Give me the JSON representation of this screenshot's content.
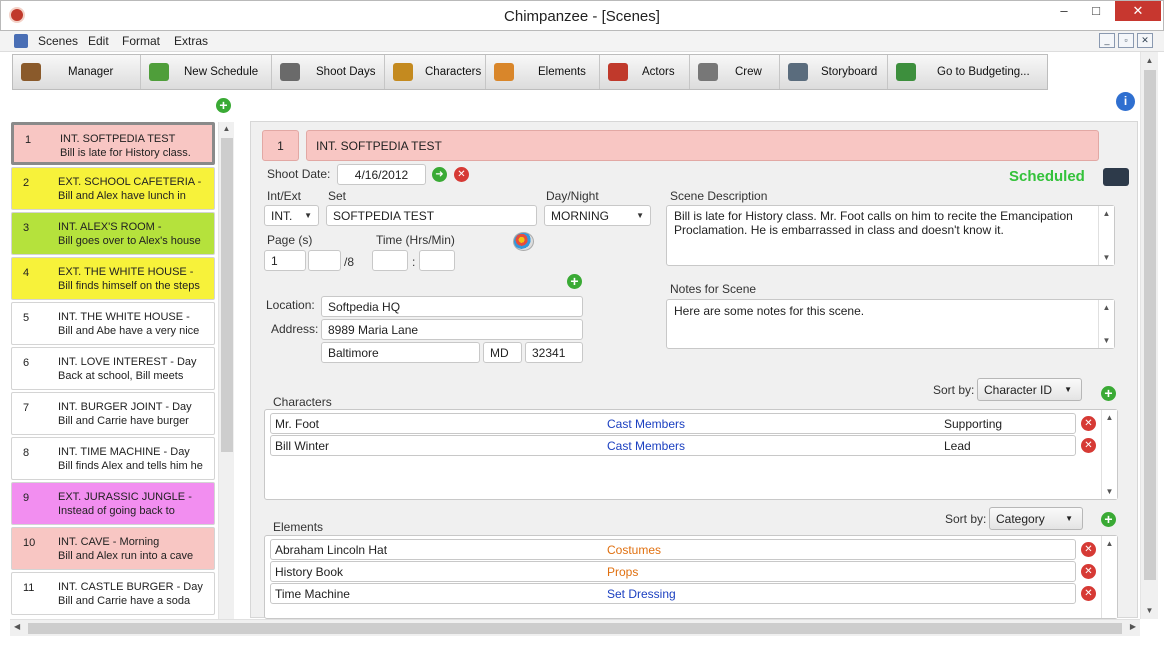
{
  "window": {
    "title": "Chimpanzee - [Scenes]",
    "minimize": "–",
    "maximize": "□",
    "close": "✕"
  },
  "menu": {
    "items": [
      "Scenes",
      "Edit",
      "Format",
      "Extras"
    ],
    "mdi": [
      "_",
      "▫",
      "✕"
    ]
  },
  "toolbar": {
    "buttons": [
      {
        "label": "Manager",
        "icon": "briefcase-icon",
        "color": "#8a5a2b"
      },
      {
        "label": "New Schedule",
        "icon": "new-schedule-icon",
        "color": "#4f9e3a"
      },
      {
        "label": "Shoot Days",
        "icon": "calendar-icon",
        "color": "#6a6a6a"
      },
      {
        "label": "Characters",
        "icon": "character-icon",
        "color": "#c48a1f"
      },
      {
        "label": "Elements",
        "icon": "gun-icon",
        "color": "#d9862a"
      },
      {
        "label": "Actors",
        "icon": "actor-icon",
        "color": "#c0392b"
      },
      {
        "label": "Crew",
        "icon": "wrench-icon",
        "color": "#777777"
      },
      {
        "label": "Storyboard",
        "icon": "storyboard-icon",
        "color": "#5a6c7d"
      },
      {
        "label": "Go to Budgeting...",
        "icon": "budget-chart-icon",
        "color": "#3d8f3d"
      }
    ]
  },
  "scenes": [
    {
      "num": "1",
      "title": "INT. SOFTPEDIA TEST",
      "desc": "Bill is late for History class.",
      "color": "#f8c6c3",
      "selected": true
    },
    {
      "num": "2",
      "title": "EXT. SCHOOL CAFETERIA -",
      "desc": "Bill and Alex have lunch in",
      "color": "#f7f23a"
    },
    {
      "num": "3",
      "title": "INT. ALEX'S ROOM -",
      "desc": "Bill goes over to Alex's house",
      "color": "#b5e23c"
    },
    {
      "num": "4",
      "title": "EXT. THE WHITE HOUSE -",
      "desc": "Bill finds himself on the steps",
      "color": "#f7f23a"
    },
    {
      "num": "5",
      "title": "INT. THE WHITE HOUSE -",
      "desc": "Bill and Abe have a very nice",
      "color": "#ffffff"
    },
    {
      "num": "6",
      "title": "INT. LOVE INTEREST - Day",
      "desc": "Back at school, Bill meets",
      "color": "#ffffff"
    },
    {
      "num": "7",
      "title": "INT. BURGER JOINT - Day",
      "desc": "Bill and Carrie have burger",
      "color": "#ffffff"
    },
    {
      "num": "8",
      "title": "INT. TIME MACHINE - Day",
      "desc": "Bill finds Alex and tells him he",
      "color": "#ffffff"
    },
    {
      "num": "9",
      "title": "EXT. JURASSIC JUNGLE -",
      "desc": "Instead of going back to",
      "color": "#f28ef0"
    },
    {
      "num": "10",
      "title": "INT. CAVE - Morning",
      "desc": "Bill and Alex run into a cave",
      "color": "#f8c6c3"
    },
    {
      "num": "11",
      "title": "INT. CASTLE BURGER - Day",
      "desc": "Bill and Carrie have a soda",
      "color": "#ffffff"
    }
  ],
  "detail": {
    "scene_num": "1",
    "scene_heading": "INT. SOFTPEDIA TEST",
    "shoot_date_label": "Shoot Date:",
    "shoot_date": "4/16/2012",
    "status": "Scheduled",
    "intext_label": "Int/Ext",
    "intext": "INT.",
    "set_label": "Set",
    "set": "SOFTPEDIA TEST",
    "daynight_label": "Day/Night",
    "daynight": "MORNING",
    "scene_desc_label": "Scene Description",
    "scene_desc": "Bill is late for History class. Mr. Foot calls on him to recite the Emancipation Proclamation. He is embarrassed in class and doesn't know it.",
    "page_label": "Page (s)",
    "page_whole": "1",
    "page_eighths": "",
    "page_suffix": "/8",
    "time_label": "Time (Hrs/Min)",
    "time_h": "",
    "time_sep": ":",
    "time_m": "",
    "notes_label": "Notes for Scene",
    "notes": "Here are some notes for this scene.",
    "location_label": "Location:",
    "location": "Softpedia HQ",
    "address_label": "Address:",
    "address": "8989 Maria Lane",
    "city": "Baltimore",
    "state": "MD",
    "zip": "32341"
  },
  "characters": {
    "label": "Characters",
    "sort_label": "Sort by:",
    "sort_value": "Character ID",
    "rows": [
      {
        "name": "Mr. Foot",
        "group": "Cast Members",
        "role": "Supporting"
      },
      {
        "name": "Bill Winter",
        "group": "Cast Members",
        "role": "Lead"
      }
    ]
  },
  "elements": {
    "label": "Elements",
    "sort_label": "Sort by:",
    "sort_value": "Category",
    "rows": [
      {
        "name": "Abraham Lincoln Hat",
        "category": "Costumes",
        "color": "#e07010"
      },
      {
        "name": "History Book",
        "category": "Props",
        "color": "#e07010"
      },
      {
        "name": "Time Machine",
        "category": "Set Dressing",
        "color": "#1a3fc0"
      }
    ]
  },
  "colors": {
    "scheduled": "#33c23a",
    "link_blue": "#1a3fc0",
    "heading_pink": "#f8c6c3"
  }
}
